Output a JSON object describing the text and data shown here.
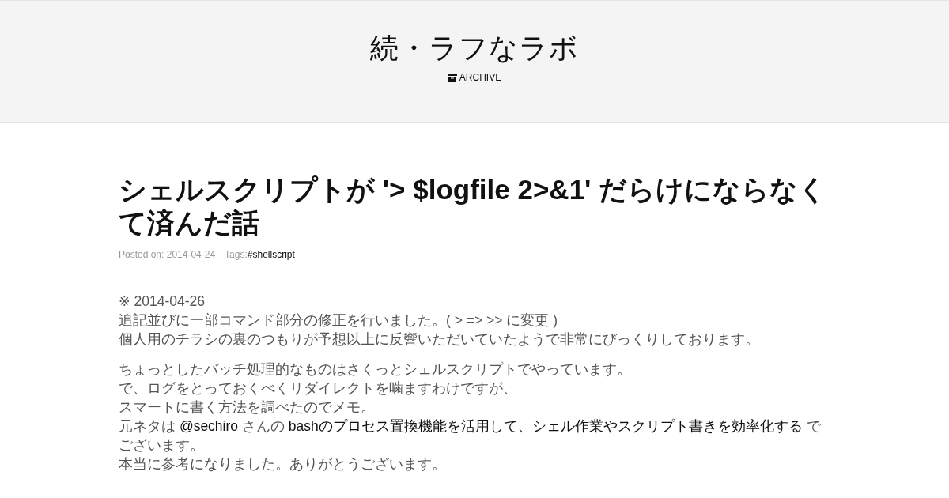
{
  "site": {
    "title": "続・ラフなラボ",
    "nav": [
      {
        "label": "ARCHIVE"
      }
    ]
  },
  "post": {
    "title": "シェルスクリプトが '> $logfile 2>&1' だらけにならなくて済んだ話",
    "posted": "Posted on: 2014-04-24",
    "tags_label": "Tags:",
    "tags": [
      "#shellscript"
    ],
    "paragraphs": [
      {
        "lines": [
          [
            {
              "kind": "text",
              "text": "※ 2014-04-26"
            }
          ],
          [
            {
              "kind": "text",
              "text": "追記並びに一部コマンド部分の修正を行いました。( > => >> に変更 )"
            }
          ],
          [
            {
              "kind": "text",
              "text": "個人用のチラシの裏のつもりが予想以上に反響いただいていたようで非常にびっくりしております。"
            }
          ]
        ]
      },
      {
        "lines": [
          [
            {
              "kind": "text",
              "text": "ちょっとしたバッチ処理的なものはさくっとシェルスクリプトでやっています。"
            }
          ],
          [
            {
              "kind": "text",
              "text": "で、ログをとっておくべくリダイレクトを噛ますわけですが、"
            }
          ],
          [
            {
              "kind": "text",
              "text": "スマートに書く方法を調べたのでメモ。"
            }
          ],
          [
            {
              "kind": "text",
              "text": "元ネタは "
            },
            {
              "kind": "link",
              "text": "@sechiro"
            },
            {
              "kind": "text",
              "text": " さんの "
            },
            {
              "kind": "link",
              "text": "bashのプロセス置換機能を活用して、シェル作業やスクリプト書きを効率化する"
            },
            {
              "kind": "text",
              "text": " でございます。"
            }
          ],
          [
            {
              "kind": "text",
              "text": "本当に参考になりました。ありがとうございます。"
            }
          ]
        ]
      }
    ]
  }
}
